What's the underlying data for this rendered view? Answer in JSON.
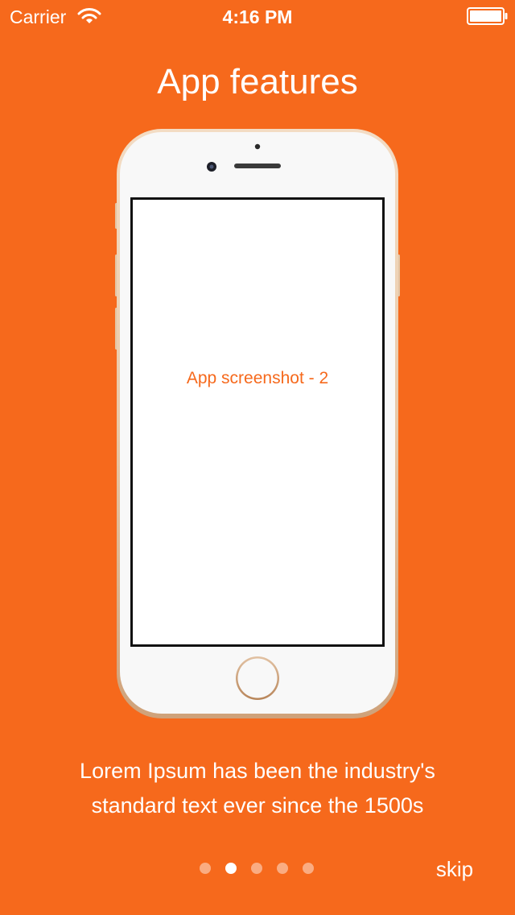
{
  "colors": {
    "background": "#f6691c",
    "accent": "#f6691c",
    "text_light": "#ffffff"
  },
  "status_bar": {
    "carrier": "Carrier",
    "time": "4:16 PM",
    "icons": [
      "wifi-icon",
      "battery-icon"
    ]
  },
  "page": {
    "title": "App features",
    "screenshot_label": "App screenshot - 2",
    "description_line1": "Lorem Ipsum has been the industry's",
    "description_line2": "standard text ever since the 1500s"
  },
  "pager": {
    "total_pages": 5,
    "current_page": 2
  },
  "skip_label": "skip"
}
